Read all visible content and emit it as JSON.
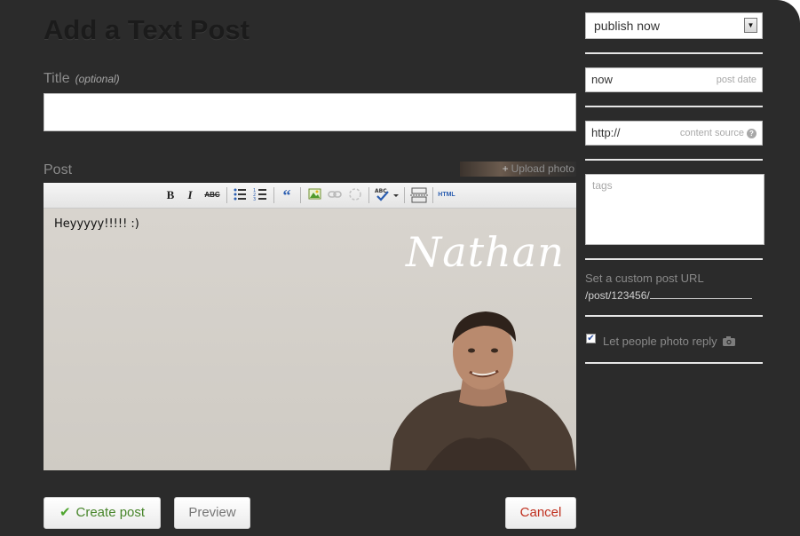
{
  "page": {
    "title": "Add a Text Post"
  },
  "title_field": {
    "label": "Title",
    "optional_label": "(optional)",
    "value": ""
  },
  "post_field": {
    "label": "Post",
    "upload_photo_label": "Upload photo"
  },
  "toolbar": {
    "items": [
      {
        "name": "bold-button",
        "glyph": "B"
      },
      {
        "name": "italic-button",
        "glyph": "I"
      },
      {
        "name": "strikethrough-button",
        "glyph": "ABC"
      },
      {
        "name": "bullet-list-button",
        "glyph": "bullets"
      },
      {
        "name": "numbered-list-button",
        "glyph": "numbers"
      },
      {
        "name": "blockquote-button",
        "glyph": "“"
      },
      {
        "name": "insert-image-button",
        "glyph": "image"
      },
      {
        "name": "insert-link-button",
        "glyph": "link"
      },
      {
        "name": "remove-link-button",
        "glyph": "unlink"
      },
      {
        "name": "spellcheck-button",
        "glyph": "ABC"
      },
      {
        "name": "read-more-button",
        "glyph": "pagebreak"
      },
      {
        "name": "html-button",
        "glyph": "HTML"
      }
    ]
  },
  "editor": {
    "content": "Heyyyyy!!!!! :)",
    "background_signature_text": "Nathan"
  },
  "actions": {
    "create_label": "Create post",
    "preview_label": "Preview",
    "cancel_label": "Cancel"
  },
  "sidebar": {
    "publish_select": {
      "value": "publish now"
    },
    "post_date": {
      "value": "now",
      "hint": "post date"
    },
    "content_source": {
      "value": "http://",
      "hint": "content source"
    },
    "tags": {
      "placeholder": "tags"
    },
    "custom_url": {
      "label": "Set a custom post URL",
      "path": "/post/123456/"
    },
    "photo_reply": {
      "label": "Let people photo reply",
      "checked": true
    }
  },
  "colors": {
    "panel_bg": "#2b2b2b",
    "create_text": "#47852a",
    "cancel_text": "#c0301f",
    "label_text": "#8a8a8a"
  },
  "icons": {
    "create_button": "checkmark-icon",
    "content_source_help": "help-icon",
    "photo_reply": "camera-icon",
    "select": "chevron-down-icon",
    "upload": "plus-icon"
  }
}
